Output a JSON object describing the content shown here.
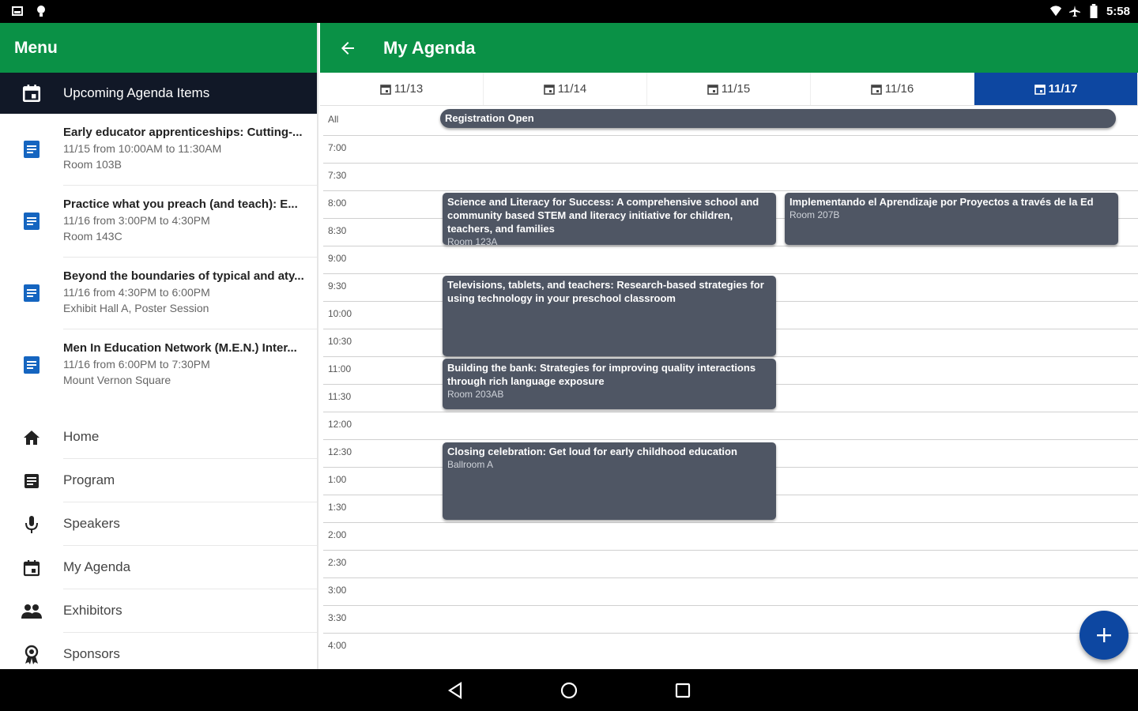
{
  "status_bar": {
    "time": "5:58"
  },
  "sidebar": {
    "title": "Menu",
    "section_title": "Upcoming Agenda Items",
    "agenda_items": [
      {
        "title": "Early educator apprenticeships: Cutting-...",
        "when": "11/15 from 10:00AM to 11:30AM",
        "where": "Room 103B"
      },
      {
        "title": "Practice what you preach (and teach): E...",
        "when": "11/16 from 3:00PM to 4:30PM",
        "where": "Room 143C"
      },
      {
        "title": "Beyond the boundaries of typical and aty...",
        "when": "11/16 from 4:30PM to 6:00PM",
        "where": "Exhibit Hall A, Poster Session"
      },
      {
        "title": "Men In Education Network (M.E.N.) Inter...",
        "when": "11/16 from 6:00PM to 7:30PM",
        "where": "Mount Vernon Square"
      }
    ],
    "nav": [
      {
        "label": "Home",
        "icon": "home-icon"
      },
      {
        "label": "Program",
        "icon": "program-icon"
      },
      {
        "label": "Speakers",
        "icon": "microphone-icon"
      },
      {
        "label": "My Agenda",
        "icon": "calendar-icon"
      },
      {
        "label": "Exhibitors",
        "icon": "people-icon"
      },
      {
        "label": "Sponsors",
        "icon": "ribbon-icon"
      }
    ]
  },
  "main": {
    "title": "My Agenda",
    "tabs": [
      {
        "label": "11/13",
        "active": false
      },
      {
        "label": "11/14",
        "active": false
      },
      {
        "label": "11/15",
        "active": false
      },
      {
        "label": "11/16",
        "active": false
      },
      {
        "label": "11/17",
        "active": true
      }
    ],
    "time_labels": [
      "All",
      "7:00",
      "7:30",
      "8:00",
      "8:30",
      "9:00",
      "9:30",
      "10:00",
      "10:30",
      "11:00",
      "11:30",
      "12:00",
      "12:30",
      "1:00",
      "1:30",
      "2:00",
      "2:30",
      "3:00",
      "3:30",
      "4:00"
    ],
    "events": [
      {
        "title": "Registration Open",
        "room": ""
      },
      {
        "title": "Science and Literacy for Success: A comprehensive school and community based STEM and literacy initiative for children, teachers, and families",
        "room": "Room 123A"
      },
      {
        "title": "Implementando el Aprendizaje por Proyectos a través de la Ed",
        "room": "Room 207B"
      },
      {
        "title": "Televisions, tablets, and teachers: Research-based strategies for using technology in your preschool classroom",
        "room": ""
      },
      {
        "title": "Building the bank: Strategies for improving quality interactions through rich language exposure",
        "room": "Room 203AB"
      },
      {
        "title": "Closing celebration: Get loud for early childhood education",
        "room": "Ballroom A"
      }
    ]
  },
  "colors": {
    "header_green": "#0a9146",
    "active_tab_blue": "#0d47a1",
    "event_gray": "#4f5664",
    "section_dark": "#111827"
  }
}
